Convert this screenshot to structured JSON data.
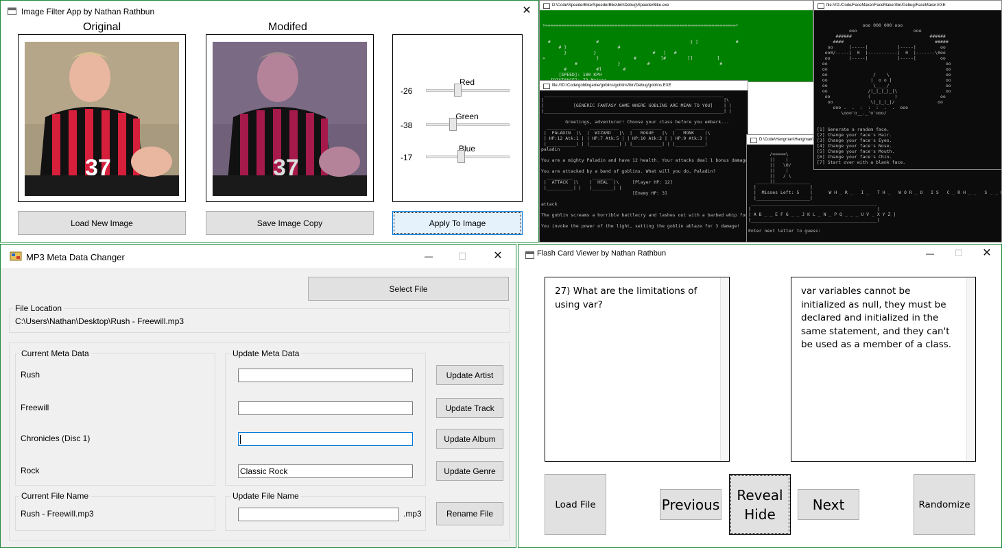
{
  "image_filter": {
    "title": "Image Filter App by Nathan Rathbun",
    "original_label": "Original",
    "modified_label": "Modifed",
    "sliders": [
      {
        "name": "Red",
        "value": "-26",
        "level": -26
      },
      {
        "name": "Green",
        "value": "-38",
        "level": -38
      },
      {
        "name": "Blue",
        "value": "-17",
        "level": -17
      }
    ],
    "load_button": "Load New Image",
    "save_button": "Save Image Copy",
    "apply_button": "Apply To Image",
    "close_glyph": "✕"
  },
  "console_speedbike": {
    "title": "D:\\Code\\SpeederBike\\SpeederBike\\bin\\Debug\\SpeederBike.exe",
    "border_line": "+=======================================================================+",
    "lines": [
      "  #                 #                                  } ]              #",
      "      # }                   #                                         ",
      "        }          }                     #   ]   #                     ",
      ">                   }             #         ]#        ]]         ]     ",
      "            #               }          #                          #   ",
      "        #           #]        #                                       ",
      "      [SPEED]: 100 KPH",
      "   [DISTANCE]: 73 Meters"
    ]
  },
  "console_facemaker": {
    "title": "file:///D:/Code/FaceMaker/FaceMaker/bin/Debug/FaceMaker.EXE",
    "art": [
      "                 ooo 000 000 ooo",
      "            ooo                     ooo",
      "       ######                             ######",
      "      ####                                  #####",
      "    oo      |-----|           |-----|         oo",
      "   oo0/-----|  0  |-----------|  0  |-------\\0oo",
      "   oo       |-----|           |-----|         oo",
      "  oo                                            oo",
      "  oo                                            oo",
      "  oo                 /    \\                     oo",
      "  oo                |  o o |                    oo",
      "  oo                 \\____/                     oo",
      "  oo               /|_|_|_|_|\\                  oo",
      "   oo              (         )                oo",
      "    oo              \\|_|_|_|/                oo",
      "      ooo .  .  :  :  :  .  .  ooo",
      "         \\ooo'o__._'o'ooo/"
    ],
    "menu": [
      "[1] Generate a random face.",
      "[2] Change your face's Hair.",
      "[3] Change your face's Eyes.",
      "[4] Change your face's Nose.",
      "[5] Change your face's Mouth.",
      "[6] Change your face's Chin.",
      "[7] Start over with a blank face."
    ]
  },
  "console_goblins": {
    "title": "file:///D:/Code/goblingame/goblins/goblins/bin/Debug/goblins.EXE",
    "lines": [
      " ___________________________________________________________________",
      "|                                                                   |\\",
      "|           [GENERIC FANTASY GAME WHERE GOBLINS ARE MEAN TO YOU]    | |",
      "|___________________________________________________________________| |",
      "",
      "         Greetings, adventurer! Choose your class before you embark...",
      "  ___________     ___________     ___________     ___________",
      " |  PALADIN  |\\  |  WIZARD   |\\  |   ROGUE   |\\  |   MONK    |\\",
      " | HP:12 Atk:1 | | HP:7 Atk:5 | | HP:10 Atk:2 | | HP:9 Atk:3 |",
      " |___________| | |___________| | |___________| | |___________|",
      "paladin",
      "",
      "You are a mighty Paladin and have 12 health. Your attacks deal 1 bonus damage.",
      "",
      "You are attacked by a band of goblins. What will you do, Paladin?",
      "  __________       ________",
      " |  ATTACK  |\\    |  HEAL  |\\     [Player HP: 12]",
      " |__________| |   |________| |",
      "                                  [Enemy HP: 3]",
      "",
      "attack",
      "",
      "The goblin screams a horrible battlecry and lashes out with a barbed whip for 1 d",
      "",
      "You invoke the power of the light, setting the goblin ablaze for 3 damage!"
    ]
  },
  "console_hangman": {
    "title": "D:\\Code\\Hangman\\Hangman\\bin\\Debug\\Hangman.exe",
    "lines": [
      "",
      "        /=====\\",
      "        ||    |",
      "        ||   \\O/",
      "        ||    |",
      "        ||   / \\",
      "   _____||_____________",
      "  |                    |",
      "  |  Misses Left: 5    |      W H _ R _   I _   T H _   W O R _ O   I S   C _ R H _ _   S _ _ D I _ O",
      "  |____________________|",
      " _______________________________________________",
      "|                                               |",
      "| A B _ _ E F G _ _ J K L _ N _ P Q _ _ _ U V _ X Y Z |",
      "|_______________________________________________|",
      "",
      "Enter next letter to guess:"
    ]
  },
  "mp3": {
    "title": "MP3 Meta Data Changer",
    "select_file": "Select File",
    "file_location_label": "File Location",
    "file_location": "C:\\Users\\Nathan\\Desktop\\Rush - Freewill.mp3",
    "current_meta_label": "Current Meta Data",
    "update_meta_label": "Update Meta Data",
    "current": {
      "artist": "Rush",
      "track": "Freewill",
      "album": "Chronicles (Disc 1)",
      "genre": "Rock"
    },
    "inputs": {
      "artist": "",
      "track": "",
      "album": "",
      "genre": "Classic Rock"
    },
    "buttons": {
      "artist": "Update Artist",
      "track": "Update Track",
      "album": "Update Album",
      "genre": "Update Genre",
      "rename": "Rename File"
    },
    "current_file_name_label": "Current File Name",
    "current_file_name": "Rush - Freewill.mp3",
    "update_file_name_label": "Update File Name",
    "new_file_name": "",
    "extension": ".mp3",
    "min_glyph": "—",
    "max_glyph": "☐",
    "close_glyph": "✕"
  },
  "flashcard": {
    "title": "Flash Card Viewer by Nathan Rathbun",
    "question": "27) What are the limitations of using var?",
    "answer": "var variables cannot be initialized as null, they must be declared and initialized in the same statement, and they can't be used as a member of a class.",
    "load_file": "Load File",
    "previous": "Previous",
    "reveal_line1": "Reveal",
    "reveal_line2": "Hide",
    "next": "Next",
    "randomize": "Randomize",
    "min_glyph": "—",
    "max_glyph": "☐",
    "close_glyph": "✕"
  },
  "colors": {
    "console_green": "#008000",
    "console_black": "#0c0c0c",
    "window_gray": "#f0f0f0",
    "focus_blue": "#0078d7"
  }
}
